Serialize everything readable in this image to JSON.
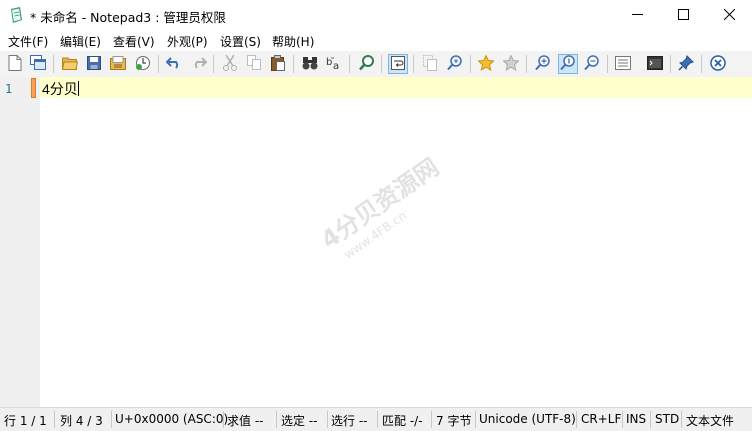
{
  "window": {
    "title": "* 未命名 - Notepad3 : 管理员权限",
    "buttons": {
      "minimize": "─",
      "maximize": "☐",
      "close": "✕"
    }
  },
  "menu": [
    "文件(F)",
    "编辑(E)",
    "查看(V)",
    "外观(P)",
    "设置(S)",
    "帮助(H)"
  ],
  "toolbar": {
    "icons": [
      "new-file-icon",
      "new-window-icon",
      "open-folder-icon",
      "save-icon",
      "save-as-icon",
      "revert-icon",
      "undo-icon",
      "redo-icon",
      "cut-icon",
      "copy-icon",
      "paste-icon",
      "find-icon",
      "replace-icon",
      "goto-icon",
      "word-wrap-icon",
      "select-all-icon",
      "find-next-icon",
      "favorites-icon",
      "add-favorite-icon",
      "zoom-in-icon",
      "zoom-reset-icon",
      "zoom-out-icon",
      "scheme-icon",
      "customize-icon",
      "pin-icon",
      "exit-icon"
    ]
  },
  "editor": {
    "line_number": "1",
    "text": "4分贝"
  },
  "watermark": {
    "line1": "4分贝资源网",
    "line2": "www.4FB.cn"
  },
  "status": {
    "line": "行  1 / 1",
    "column": "列  4 / 3",
    "char": "U+0x0000 (ASC:0)",
    "eval": "求值  --",
    "selection": "选定  --",
    "selected_lines": "选行  --",
    "match": "匹配  -/-",
    "bytes": "7 字节",
    "encoding": "Unicode (UTF-8)",
    "eol": "CR+LF",
    "ovr": "INS",
    "mode": "STD",
    "lexer": "文本文件"
  },
  "colors": {
    "current_line": "#ffffcc",
    "line_number": "#1a7b7b",
    "change_marker": "#f5a35b",
    "active_button": "#cde6f7"
  }
}
